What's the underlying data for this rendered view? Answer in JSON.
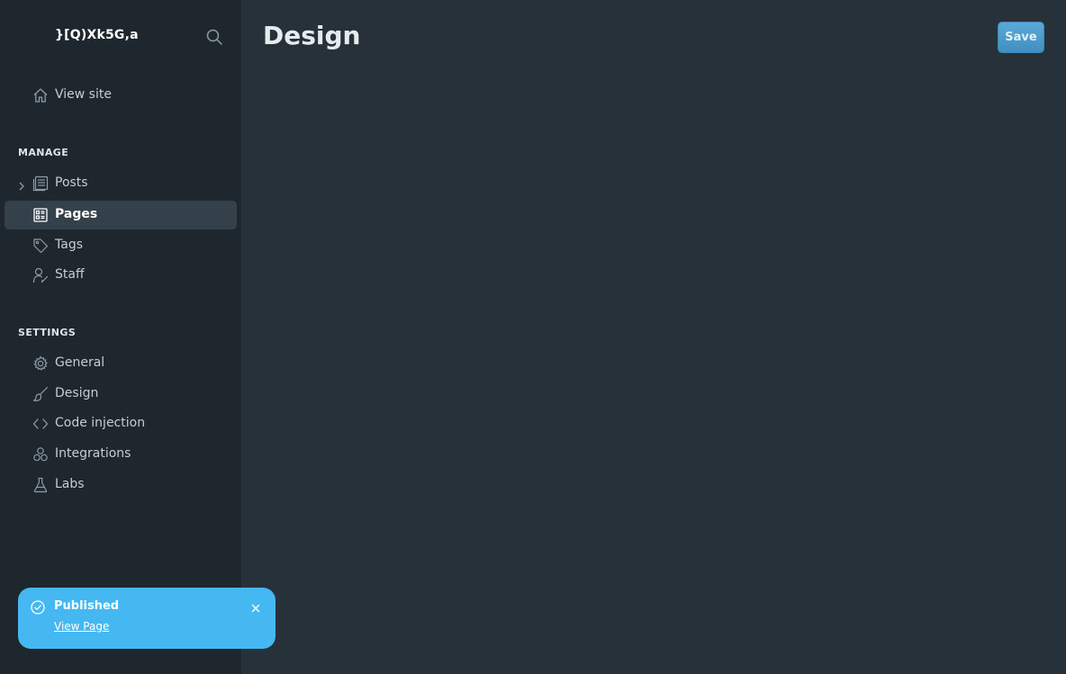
{
  "site": {
    "title": "}[Q)Xk5G,a"
  },
  "sidebar": {
    "view_site": "View site",
    "manage_label": "MANAGE",
    "manage_items": [
      {
        "label": "Posts",
        "icon": "posts-icon"
      },
      {
        "label": "Pages",
        "icon": "pages-icon",
        "active": true
      },
      {
        "label": "Tags",
        "icon": "tag-icon"
      },
      {
        "label": "Staff",
        "icon": "staff-icon"
      }
    ],
    "settings_label": "SETTINGS",
    "settings_items": [
      {
        "label": "General",
        "icon": "gear-icon"
      },
      {
        "label": "Design",
        "icon": "brush-icon"
      },
      {
        "label": "Code injection",
        "icon": "code-icon"
      },
      {
        "label": "Integrations",
        "icon": "integrations-icon"
      },
      {
        "label": "Labs",
        "icon": "flask-icon"
      }
    ]
  },
  "main": {
    "title": "Design",
    "save_label": "Save"
  },
  "toast": {
    "title": "Published",
    "link": "View Page"
  },
  "colors": {
    "sidebar_bg": "#1f272e",
    "main_bg": "#26313a",
    "active_item_bg": "#34414b",
    "accent": "#45b8f2",
    "save_button": "#4a9acb"
  }
}
